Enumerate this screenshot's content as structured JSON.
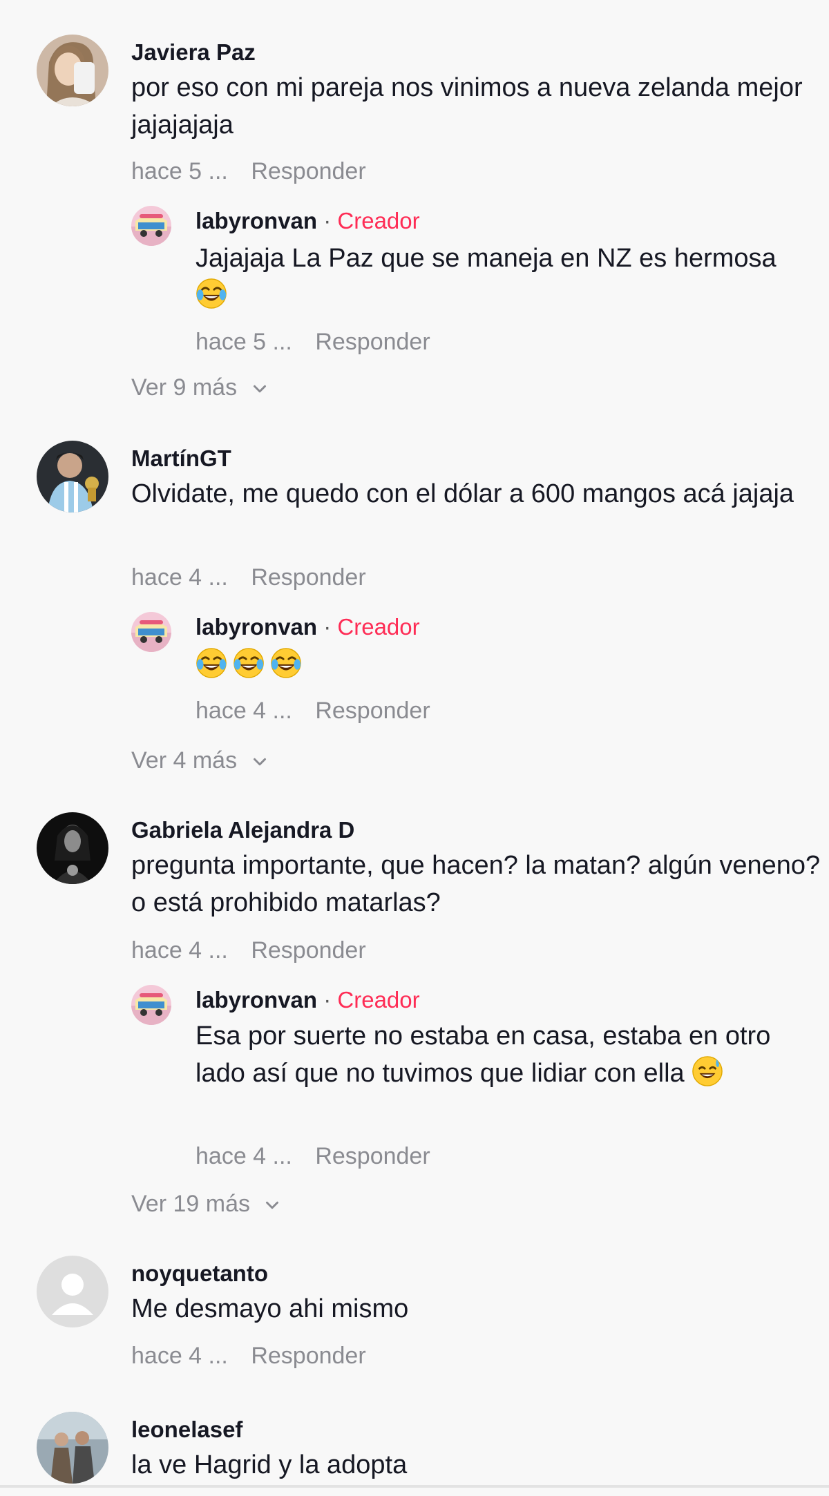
{
  "reply_label": "Responder",
  "creator_label": "Creador",
  "separator": "·",
  "comments": [
    {
      "username": "Javiera Paz",
      "text": "por eso con mi pareja nos vinimos a nueva zelanda mejor jajajajaja",
      "time": "hace 5 ...",
      "reply": {
        "username": "labyronvan",
        "text": "Jajajaja La Paz que se maneja en NZ es hermosa",
        "time": "hace 5 ..."
      },
      "more": "Ver 9 más"
    },
    {
      "username": "MartínGT",
      "text": "Olvidate, me quedo con el dólar a 600 mangos acá jajaja",
      "time": "hace 4 ...",
      "reply": {
        "username": "labyronvan",
        "text": "",
        "time": "hace 4 ..."
      },
      "more": "Ver 4 más"
    },
    {
      "username": "Gabriela Alejandra D",
      "text": "pregunta importante, que hacen? la matan? algún veneno? o está prohibido matarlas?",
      "time": "hace 4 ...",
      "reply": {
        "username": "labyronvan",
        "text": "Esa por suerte no estaba en casa, estaba en otro lado así que no tuvimos que lidiar con ella",
        "time": "hace 4 ..."
      },
      "more": "Ver 19 más"
    },
    {
      "username": "noyquetanto",
      "text": "Me desmayo ahi mismo",
      "time": "hace 4 ..."
    },
    {
      "username": "leonelasef",
      "text": "la ve Hagrid y la adopta"
    }
  ],
  "icons": {
    "expand": "chevron-down-icon",
    "laugh": "tears-of-joy-emoji",
    "sweat": "grinning-sweat-emoji"
  },
  "colors": {
    "creator": "#fe2c55",
    "meta": "#8a8b91",
    "background": "#f8f8f8"
  }
}
